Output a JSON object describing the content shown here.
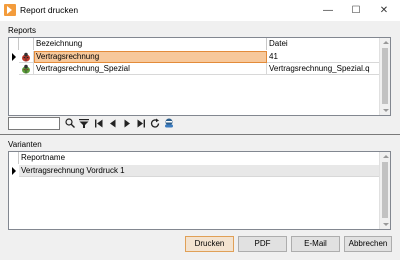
{
  "window": {
    "title": "Report drucken",
    "minimize": "—",
    "maximize": "☐",
    "close": "✕"
  },
  "reports": {
    "label": "Reports",
    "label_mnemonic": "p",
    "columns": [
      "Bezeichnung",
      "Datei"
    ],
    "rows": [
      {
        "bezeichnung": "Vertragsrechnung",
        "datei": "41",
        "selected": true,
        "icon": "red-ladybug-icon"
      },
      {
        "bezeichnung": "Vertragsrechnung_Spezial",
        "datei": "Vertragsrechnung_Spezial.q",
        "selected": false,
        "icon": "green-ladybug-icon"
      }
    ]
  },
  "navigator": {
    "search_value": "",
    "icons": [
      "search-icon",
      "filter-icon",
      "first-record-icon",
      "prior-record-icon",
      "next-record-icon",
      "last-record-icon",
      "refresh-icon",
      "user-icon"
    ]
  },
  "variants": {
    "label": "Varianten",
    "label_mnemonic": "n",
    "columns": [
      "Reportname"
    ],
    "rows": [
      {
        "reportname": "Vertragsrechnung Vordruck 1"
      }
    ]
  },
  "buttons": {
    "print": "Drucken",
    "pdf": "PDF",
    "email": "E-Mail",
    "cancel": "Abbrechen"
  },
  "colors": {
    "accent": "#f39c3c",
    "selection": "#f7c89b"
  }
}
